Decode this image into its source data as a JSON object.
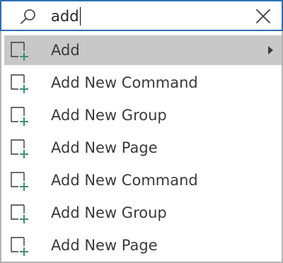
{
  "search": {
    "value": "add",
    "icon": "search-icon",
    "clear_icon": "close-icon",
    "focus_color": "#2f6fb3"
  },
  "results": {
    "selected_background": "#c8c8c8",
    "icon_color": "#3f8f6f",
    "items": [
      {
        "label": "Add",
        "icon": "add-item-icon",
        "has_submenu": true,
        "selected": true
      },
      {
        "label": "Add New Command",
        "icon": "add-item-icon",
        "has_submenu": false,
        "selected": false
      },
      {
        "label": "Add New Group",
        "icon": "add-item-icon",
        "has_submenu": false,
        "selected": false
      },
      {
        "label": "Add New Page",
        "icon": "add-item-icon",
        "has_submenu": false,
        "selected": false
      },
      {
        "label": "Add New Command",
        "icon": "add-item-icon",
        "has_submenu": false,
        "selected": false
      },
      {
        "label": "Add New Group",
        "icon": "add-item-icon",
        "has_submenu": false,
        "selected": false
      },
      {
        "label": "Add New Page",
        "icon": "add-item-icon",
        "has_submenu": false,
        "selected": false
      }
    ]
  }
}
